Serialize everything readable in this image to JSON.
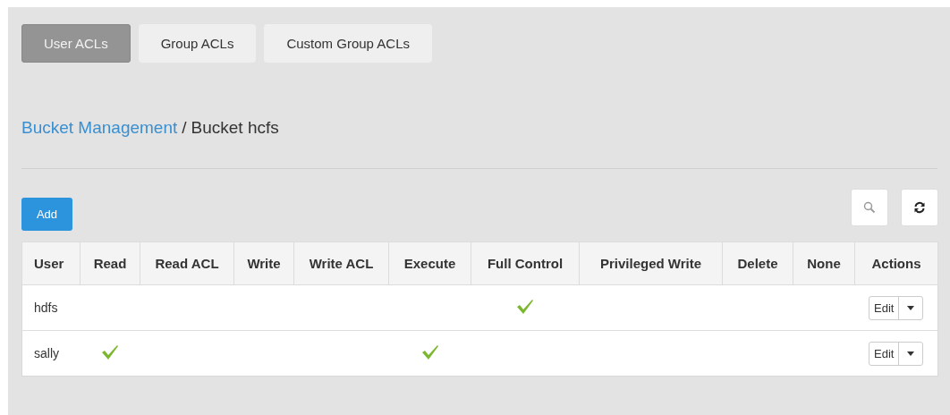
{
  "tabs": [
    {
      "label": "User ACLs",
      "selected": true
    },
    {
      "label": "Group ACLs",
      "selected": false
    },
    {
      "label": "Custom Group ACLs",
      "selected": false
    }
  ],
  "breadcrumb": {
    "link": "Bucket Management",
    "separator": "/",
    "current": "Bucket hcfs"
  },
  "toolbar": {
    "add_button": "Add"
  },
  "table": {
    "columns": [
      "User",
      "Read",
      "Read ACL",
      "Write",
      "Write ACL",
      "Execute",
      "Full Control",
      "Privileged Write",
      "Delete",
      "None",
      "Actions"
    ],
    "rows": [
      {
        "user": "hdfs",
        "permissions": [
          false,
          false,
          false,
          false,
          false,
          true,
          false,
          false,
          false
        ],
        "action": "Edit"
      },
      {
        "user": "sally",
        "permissions": [
          true,
          false,
          false,
          false,
          true,
          false,
          false,
          false,
          false
        ],
        "action": "Edit"
      }
    ]
  }
}
